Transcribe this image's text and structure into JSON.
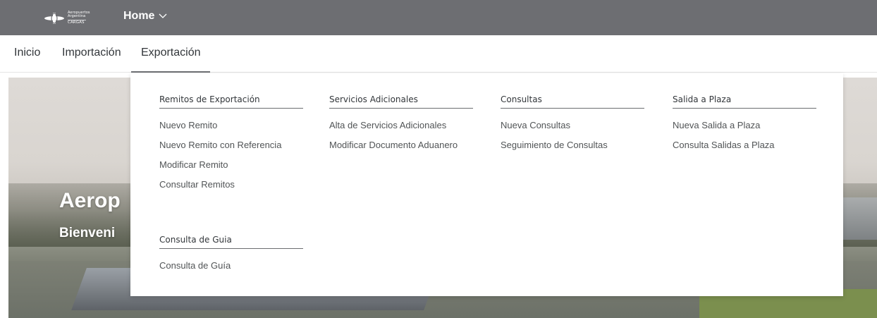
{
  "shell": {
    "logo_line1": "Aeropuertos",
    "logo_line2": "Argentina",
    "logo_line3": "CARGAS",
    "title": "Home"
  },
  "nav": {
    "items": [
      "Inicio",
      "Importación",
      "Exportación"
    ],
    "active": "Exportación"
  },
  "hero": {
    "title": "Aerop",
    "subtitle": "Bienveni"
  },
  "menu": {
    "remitos": {
      "header": "Remitos de Exportación",
      "links": [
        "Nuevo Remito",
        "Nuevo Remito con Referencia",
        "Modificar Remito",
        "Consultar Remitos"
      ]
    },
    "servicios": {
      "header": "Servicios Adicionales",
      "links": [
        "Alta de Servicios Adicionales",
        "Modificar Documento Aduanero"
      ]
    },
    "consultas": {
      "header": "Consultas",
      "links": [
        "Nueva Consultas",
        "Seguimiento de Consultas"
      ]
    },
    "salida": {
      "header": "Salida a Plaza",
      "links": [
        "Nueva Salida a Plaza",
        "Consulta Salidas a Plaza"
      ]
    },
    "guia": {
      "header": "Consulta de Guia",
      "links": [
        "Consulta de Guía"
      ]
    }
  },
  "colors": {
    "shell_bg": "#6d6e72",
    "text": "#32363a",
    "link": "#515456"
  }
}
